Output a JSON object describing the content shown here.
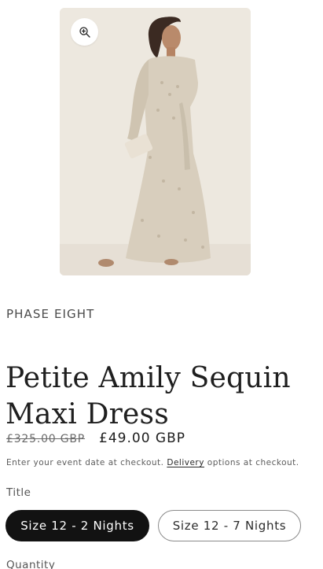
{
  "product": {
    "image_alt": "Petite Amily Sequin Maxi Dress",
    "vendor": "PHASE EIGHT",
    "title": "Petite Amily Sequin Maxi Dress",
    "price_old": "£325.00 GBP",
    "price_new": "£49.00 GBP",
    "note_before": "Enter your event date at checkout. ",
    "note_link": "Delivery",
    "note_after": " options at checkout.",
    "zoom_icon": "zoom-in-icon"
  },
  "variant": {
    "label": "Title",
    "options": [
      {
        "label": "Size 12 - 2 Nights",
        "selected": true
      },
      {
        "label": "Size 12 - 7 Nights",
        "selected": false
      }
    ]
  },
  "quantity": {
    "label": "Quantity"
  },
  "colors": {
    "text": "#121212",
    "selected_bg": "#121212",
    "selected_text": "#ffffff",
    "muted": "#555555"
  }
}
